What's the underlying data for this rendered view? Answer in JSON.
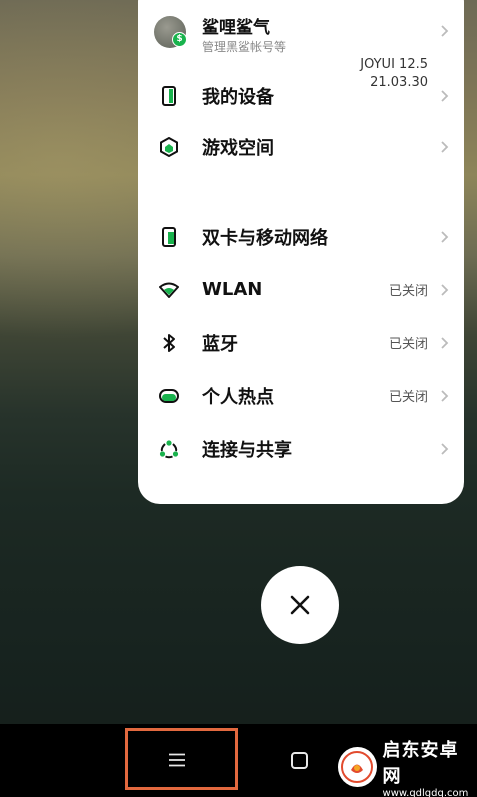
{
  "account": {
    "name": "鲨哩鲨气",
    "subtitle": "管理黑鲨帐号等",
    "badge": "$"
  },
  "device": {
    "label": "我的设备",
    "version_line1": "JOYUI 12.5",
    "version_line2": "21.03.30"
  },
  "game_space": {
    "label": "游戏空间"
  },
  "network_items": [
    {
      "label": "双卡与移动网络",
      "status": ""
    },
    {
      "label": "WLAN",
      "status": "已关闭"
    },
    {
      "label": "蓝牙",
      "status": "已关闭"
    },
    {
      "label": "个人热点",
      "status": "已关闭"
    },
    {
      "label": "连接与共享",
      "status": ""
    }
  ],
  "icons": {
    "device": "phone-device-icon",
    "game": "hexagon-game-icon",
    "sim": "sim-card-icon",
    "wlan": "wifi-icon",
    "bluetooth": "bluetooth-icon",
    "hotspot": "hotspot-icon",
    "share": "connection-share-icon",
    "close": "close-icon",
    "menu": "menu-icon",
    "home": "home-icon"
  },
  "colors": {
    "accent": "#19b34d",
    "highlight_box": "#e2693f"
  },
  "watermark": {
    "title": "启东安卓网",
    "url": "www.qdlgdq.com"
  }
}
